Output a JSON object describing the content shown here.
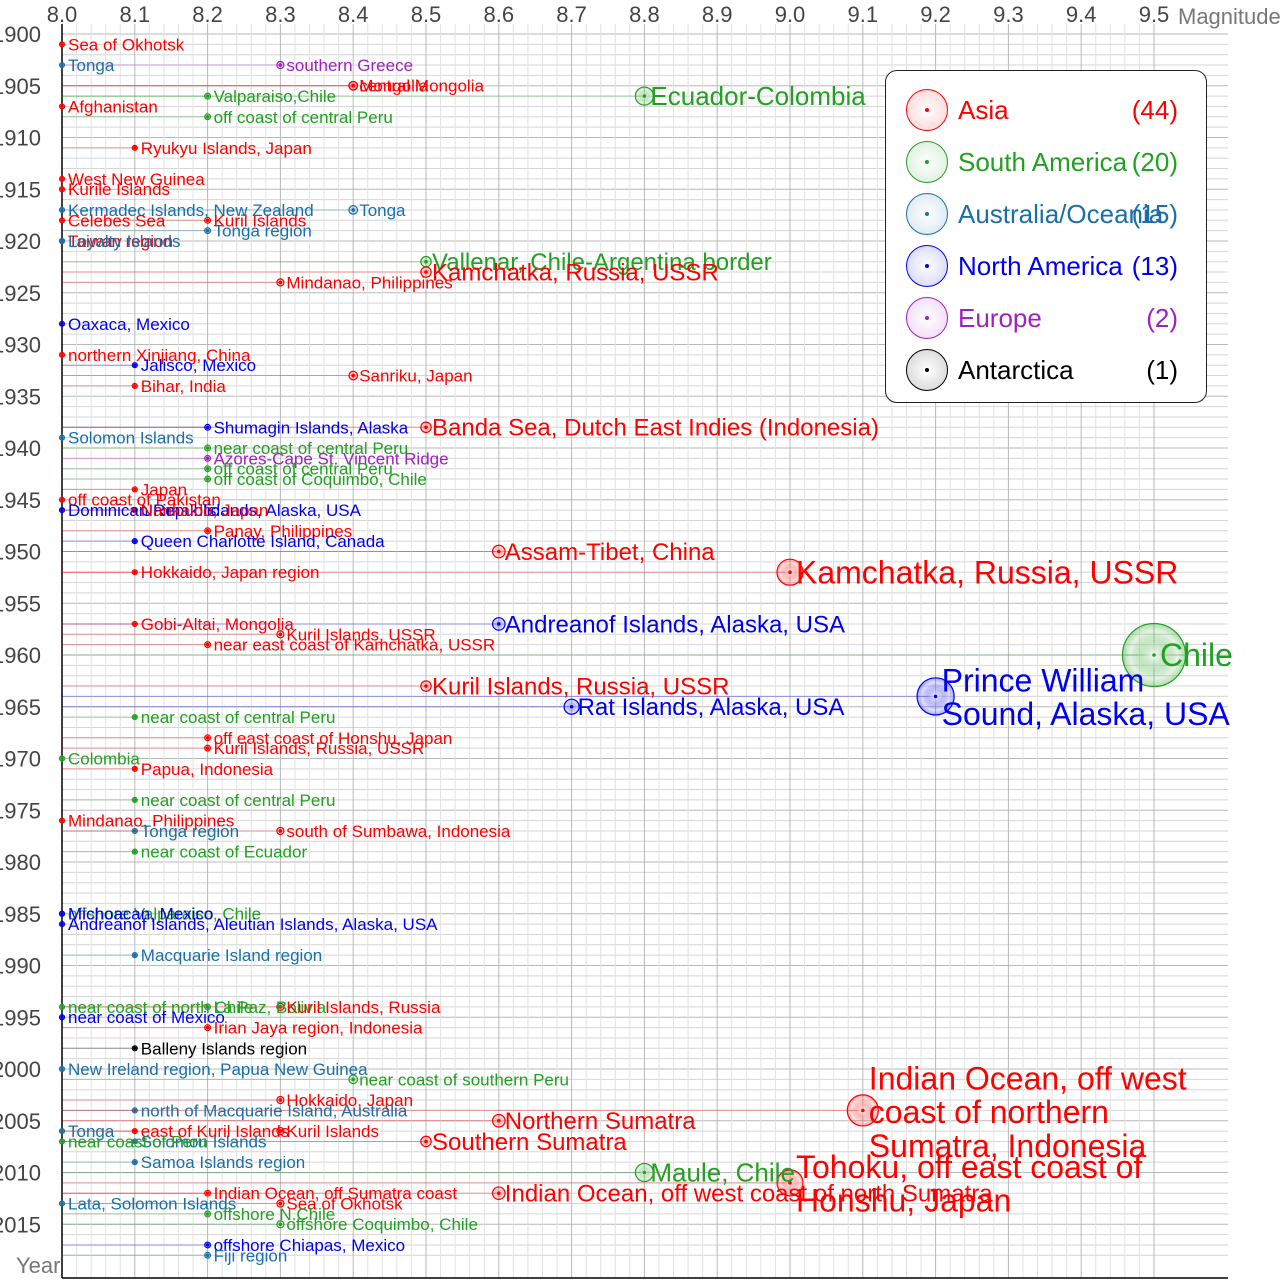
{
  "colors": {
    "Asia": "#ff0000",
    "South America": "#22a022",
    "Australia/Oceania": "#1a6fa8",
    "North America": "#0000ee",
    "Europe": "#a020c0",
    "Antarctica": "#000000"
  },
  "legend": [
    {
      "label": "Asia",
      "count": "(44)"
    },
    {
      "label": "South America",
      "count": "(20)"
    },
    {
      "label": "Australia/Oceania",
      "count": "(15)"
    },
    {
      "label": "North America",
      "count": "(13)"
    },
    {
      "label": "Europe",
      "count": "(2)"
    },
    {
      "label": "Antarctica",
      "count": "(1)"
    }
  ],
  "chart_data": {
    "type": "scatter",
    "xlabel": "Magnitude",
    "ylabel": "Year",
    "xlim": [
      8.0,
      9.5
    ],
    "ylim": [
      1900,
      2017
    ],
    "x_ticks": [
      "8.0",
      "8.1",
      "8.2",
      "8.3",
      "8.4",
      "8.5",
      "8.6",
      "8.7",
      "8.8",
      "8.9",
      "9.0",
      "9.1",
      "9.2",
      "9.3",
      "9.4",
      "9.5"
    ],
    "y_ticks": [
      "1900",
      "1905",
      "1910",
      "1915",
      "1920",
      "1925",
      "1930",
      "1935",
      "1940",
      "1945",
      "1950",
      "1955",
      "1960",
      "1965",
      "1970",
      "1975",
      "1980",
      "1985",
      "1990",
      "1995",
      "2000",
      "2005",
      "2010",
      "2015"
    ],
    "points": [
      {
        "year": 1901,
        "mag": 8.0,
        "region": "Asia",
        "label": "Sea of Okhotsk"
      },
      {
        "year": 1903,
        "mag": 8.0,
        "region": "Australia/Oceania",
        "label": "Tonga"
      },
      {
        "year": 1903,
        "mag": 8.3,
        "region": "Europe",
        "label": "southern Greece"
      },
      {
        "year": 1905,
        "mag": 8.4,
        "region": "Asia",
        "label": "Mongolia"
      },
      {
        "year": 1905,
        "mag": 8.4,
        "region": "Asia",
        "label": "central Mongolia"
      },
      {
        "year": 1906,
        "mag": 8.8,
        "region": "South America",
        "label": "Ecuador-Colombia"
      },
      {
        "year": 1906,
        "mag": 8.2,
        "region": "South America",
        "label": "Valparaiso,Chile"
      },
      {
        "year": 1907,
        "mag": 8.0,
        "region": "Asia",
        "label": "Afghanistan"
      },
      {
        "year": 1908,
        "mag": 8.2,
        "region": "South America",
        "label": "off coast of central Peru"
      },
      {
        "year": 1911,
        "mag": 8.1,
        "region": "Asia",
        "label": "Ryukyu Islands, Japan"
      },
      {
        "year": 1914,
        "mag": 8.0,
        "region": "Asia",
        "label": "West New Guinea"
      },
      {
        "year": 1915,
        "mag": 8.0,
        "region": "Asia",
        "label": "Kurile Islands"
      },
      {
        "year": 1917,
        "mag": 8.0,
        "region": "Australia/Oceania",
        "label": "Kermadec Islands, New Zealand"
      },
      {
        "year": 1917,
        "mag": 8.4,
        "region": "Australia/Oceania",
        "label": "Tonga"
      },
      {
        "year": 1918,
        "mag": 8.0,
        "region": "Asia",
        "label": "Celebes Sea"
      },
      {
        "year": 1918,
        "mag": 8.2,
        "region": "Asia",
        "label": "Kuril Islands"
      },
      {
        "year": 1919,
        "mag": 8.2,
        "region": "Australia/Oceania",
        "label": "Tonga region"
      },
      {
        "year": 1920,
        "mag": 8.0,
        "region": "Asia",
        "label": "Taiwan region"
      },
      {
        "year": 1920,
        "mag": 8.0,
        "region": "Australia/Oceania",
        "label": "Loyalty Islands"
      },
      {
        "year": 1922,
        "mag": 8.5,
        "region": "South America",
        "label": "Vallenar, Chile-Argentina border"
      },
      {
        "year": 1923,
        "mag": 8.5,
        "region": "Asia",
        "label": "Kamchatka, Russia, USSR"
      },
      {
        "year": 1924,
        "mag": 8.3,
        "region": "Asia",
        "label": "Mindanao, Philippines"
      },
      {
        "year": 1928,
        "mag": 8.0,
        "region": "North America",
        "label": "Oaxaca, Mexico"
      },
      {
        "year": 1931,
        "mag": 8.0,
        "region": "Asia",
        "label": "northern Xinjiang, China"
      },
      {
        "year": 1932,
        "mag": 8.1,
        "region": "North America",
        "label": "Jalisco, Mexico"
      },
      {
        "year": 1933,
        "mag": 8.4,
        "region": "Asia",
        "label": "Sanriku, Japan"
      },
      {
        "year": 1934,
        "mag": 8.1,
        "region": "Asia",
        "label": "Bihar, India"
      },
      {
        "year": 1938,
        "mag": 8.5,
        "region": "Asia",
        "label": "Banda Sea, Dutch East Indies (Indonesia)"
      },
      {
        "year": 1938,
        "mag": 8.2,
        "region": "North America",
        "label": "Shumagin Islands, Alaska"
      },
      {
        "year": 1939,
        "mag": 8.0,
        "region": "Australia/Oceania",
        "label": "Solomon Islands"
      },
      {
        "year": 1940,
        "mag": 8.2,
        "region": "South America",
        "label": "near coast of central Peru"
      },
      {
        "year": 1941,
        "mag": 8.2,
        "region": "Europe",
        "label": "Azores-Cape St. Vincent Ridge"
      },
      {
        "year": 1942,
        "mag": 8.2,
        "region": "South America",
        "label": "off coast of central Peru"
      },
      {
        "year": 1943,
        "mag": 8.2,
        "region": "South America",
        "label": "off coast of Coquimbo, Chile"
      },
      {
        "year": 1944,
        "mag": 8.1,
        "region": "Asia",
        "label": "Japan"
      },
      {
        "year": 1945,
        "mag": 8.0,
        "region": "Asia",
        "label": "off coast of Pakistan"
      },
      {
        "year": 1946,
        "mag": 8.1,
        "region": "North America",
        "label": "Unimak Islands, Alaska, USA"
      },
      {
        "year": 1946,
        "mag": 8.0,
        "region": "North America",
        "label": "Dominican Republic"
      },
      {
        "year": 1946,
        "mag": 8.1,
        "region": "Asia",
        "label": "Nankaido, Japan"
      },
      {
        "year": 1948,
        "mag": 8.2,
        "region": "Asia",
        "label": "Panay, Philippines"
      },
      {
        "year": 1949,
        "mag": 8.1,
        "region": "North America",
        "label": "Queen Charlotte Island, Canada"
      },
      {
        "year": 1950,
        "mag": 8.6,
        "region": "Asia",
        "label": "Assam-Tibet, China"
      },
      {
        "year": 1952,
        "mag": 8.1,
        "region": "Asia",
        "label": "Hokkaido, Japan region"
      },
      {
        "year": 1952,
        "mag": 9.0,
        "region": "Asia",
        "label": "Kamchatka, Russia, USSR"
      },
      {
        "year": 1957,
        "mag": 8.6,
        "region": "North America",
        "label": "Andreanof Islands, Alaska, USA"
      },
      {
        "year": 1957,
        "mag": 8.1,
        "region": "Asia",
        "label": "Gobi-Altai, Mongolia"
      },
      {
        "year": 1958,
        "mag": 8.3,
        "region": "Asia",
        "label": "Kuril Islands, USSR"
      },
      {
        "year": 1959,
        "mag": 8.2,
        "region": "Asia",
        "label": "near east coast of Kamchatka, USSR"
      },
      {
        "year": 1960,
        "mag": 9.5,
        "region": "South America",
        "label": "Chile"
      },
      {
        "year": 1963,
        "mag": 8.5,
        "region": "Asia",
        "label": "Kuril Islands, Russia, USSR"
      },
      {
        "year": 1964,
        "mag": 9.2,
        "region": "North America",
        "label": "Prince William Sound, Alaska, USA"
      },
      {
        "year": 1965,
        "mag": 8.7,
        "region": "North America",
        "label": "Rat Islands, Alaska, USA"
      },
      {
        "year": 1966,
        "mag": 8.1,
        "region": "South America",
        "label": "near coast of central Peru"
      },
      {
        "year": 1968,
        "mag": 8.2,
        "region": "Asia",
        "label": "off east coast of Honshu, Japan"
      },
      {
        "year": 1969,
        "mag": 8.2,
        "region": "Asia",
        "label": "Kuril Islands, Russia, USSR"
      },
      {
        "year": 1970,
        "mag": 8.0,
        "region": "South America",
        "label": "Colombia"
      },
      {
        "year": 1971,
        "mag": 8.1,
        "region": "Asia",
        "label": "Papua, Indonesia"
      },
      {
        "year": 1974,
        "mag": 8.1,
        "region": "South America",
        "label": "near coast of central Peru"
      },
      {
        "year": 1976,
        "mag": 8.0,
        "region": "Asia",
        "label": "Mindanao, Philippines"
      },
      {
        "year": 1977,
        "mag": 8.1,
        "region": "Australia/Oceania",
        "label": "Tonga region"
      },
      {
        "year": 1977,
        "mag": 8.3,
        "region": "Asia",
        "label": "south of Sumbawa, Indonesia"
      },
      {
        "year": 1979,
        "mag": 8.1,
        "region": "South America",
        "label": "near coast of Ecuador"
      },
      {
        "year": 1985,
        "mag": 8.0,
        "region": "South America",
        "label": "offshore Valparaiso, Chile"
      },
      {
        "year": 1985,
        "mag": 8.0,
        "region": "North America",
        "label": "Michoacan, Mexico"
      },
      {
        "year": 1986,
        "mag": 8.0,
        "region": "North America",
        "label": "Andreanof Islands, Aleutian Islands, Alaska, USA"
      },
      {
        "year": 1989,
        "mag": 8.1,
        "region": "Australia/Oceania",
        "label": "Macquarie Island region"
      },
      {
        "year": 1994,
        "mag": 8.2,
        "region": "South America",
        "label": "La Paz, Bolivia"
      },
      {
        "year": 1994,
        "mag": 8.3,
        "region": "Asia",
        "label": "Kuril Islands, Russia"
      },
      {
        "year": 1994,
        "mag": 8.0,
        "region": "South America",
        "label": "near coast of north Chile"
      },
      {
        "year": 1995,
        "mag": 8.0,
        "region": "North America",
        "label": "near coast of Mexico"
      },
      {
        "year": 1996,
        "mag": 8.2,
        "region": "Asia",
        "label": "Irian Jaya region, Indonesia"
      },
      {
        "year": 1998,
        "mag": 8.1,
        "region": "Antarctica",
        "label": "Balleny Islands region"
      },
      {
        "year": 2000,
        "mag": 8.0,
        "region": "Australia/Oceania",
        "label": "New Ireland region, Papua New Guinea"
      },
      {
        "year": 2001,
        "mag": 8.4,
        "region": "South America",
        "label": "near coast of southern Peru"
      },
      {
        "year": 2003,
        "mag": 8.3,
        "region": "Asia",
        "label": "Hokkaido, Japan"
      },
      {
        "year": 2004,
        "mag": 8.1,
        "region": "Australia/Oceania",
        "label": "north of Macquarie Island, Australia"
      },
      {
        "year": 2004,
        "mag": 9.1,
        "region": "Asia",
        "label": "Indian Ocean, off west coast of northern Sumatra, Indonesia"
      },
      {
        "year": 2005,
        "mag": 8.6,
        "region": "Asia",
        "label": "Northern Sumatra"
      },
      {
        "year": 2006,
        "mag": 8.3,
        "region": "Asia",
        "label": "Kuril Islands"
      },
      {
        "year": 2006,
        "mag": 8.0,
        "region": "Australia/Oceania",
        "label": "Tonga"
      },
      {
        "year": 2006,
        "mag": 8.1,
        "region": "Asia",
        "label": "east of Kuril Islands"
      },
      {
        "year": 2007,
        "mag": 8.1,
        "region": "Australia/Oceania",
        "label": "Solomon Islands"
      },
      {
        "year": 2007,
        "mag": 8.0,
        "region": "South America",
        "label": "near coast of Peru"
      },
      {
        "year": 2007,
        "mag": 8.5,
        "region": "Asia",
        "label": "Southern Sumatra"
      },
      {
        "year": 2009,
        "mag": 8.1,
        "region": "Australia/Oceania",
        "label": "Samoa Islands region"
      },
      {
        "year": 2010,
        "mag": 8.8,
        "region": "South America",
        "label": "Maule, Chile"
      },
      {
        "year": 2011,
        "mag": 9.0,
        "region": "Asia",
        "label": "Tohoku, off east coast of Honshu, Japan"
      },
      {
        "year": 2012,
        "mag": 8.6,
        "region": "Asia",
        "label": "Indian Ocean, off west coast of north Sumatra"
      },
      {
        "year": 2012,
        "mag": 8.2,
        "region": "Asia",
        "label": "Indian Ocean, off Sumatra coast"
      },
      {
        "year": 2013,
        "mag": 8.0,
        "region": "Australia/Oceania",
        "label": "Lata, Solomon Islands"
      },
      {
        "year": 2013,
        "mag": 8.3,
        "region": "Asia",
        "label": "Sea of Okhotsk"
      },
      {
        "year": 2014,
        "mag": 8.2,
        "region": "South America",
        "label": "offshore N.Chile"
      },
      {
        "year": 2015,
        "mag": 8.3,
        "region": "South America",
        "label": "offshore Coquimbo, Chile"
      },
      {
        "year": 2017,
        "mag": 8.2,
        "region": "North America",
        "label": "offshore Chiapas, Mexico"
      },
      {
        "year": 2018,
        "mag": 8.2,
        "region": "Australia/Oceania",
        "label": "Fiji region"
      }
    ]
  }
}
